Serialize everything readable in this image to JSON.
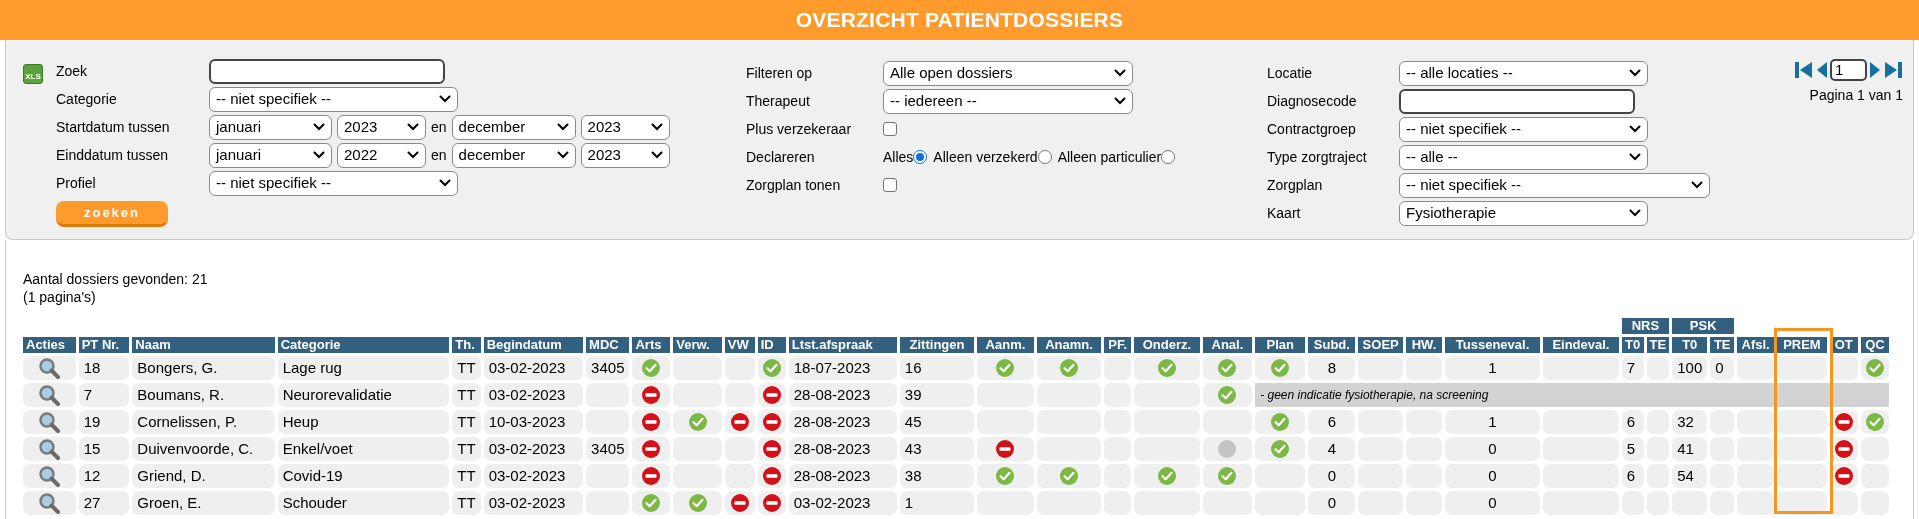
{
  "title": "OVERZICHT PATIENTDOSSIERS",
  "filters": {
    "export_label": "XLS",
    "left": [
      {
        "kind": "text",
        "label": "Zoek"
      },
      {
        "kind": "select",
        "label": "Categorie",
        "value": "-- niet specifiek --"
      },
      {
        "kind": "daterange",
        "label": "Startdatum tussen",
        "from_month": "januari",
        "from_year": "2023",
        "separator": "en",
        "to_month": "december",
        "to_year": "2023"
      },
      {
        "kind": "daterange",
        "label": "Einddatum tussen",
        "from_month": "januari",
        "from_year": "2022",
        "separator": "en",
        "to_month": "december",
        "to_year": "2023"
      },
      {
        "kind": "select",
        "label": "Profiel",
        "value": "-- niet specifiek --"
      }
    ],
    "search_button": "zoeken",
    "middle": [
      {
        "kind": "select",
        "label": "Filteren op",
        "value": "Alle open dossiers"
      },
      {
        "kind": "select",
        "label": "Therapeut",
        "value": "-- iedereen --"
      },
      {
        "kind": "checkbox",
        "label": "Plus verzekeraar",
        "checked": false
      },
      {
        "kind": "radio",
        "label": "Declareren",
        "options": [
          {
            "label": "Alles",
            "selected": true
          },
          {
            "label": "Alleen verzekerd",
            "selected": false
          },
          {
            "label": "Alleen particulier",
            "selected": false
          }
        ]
      },
      {
        "kind": "checkbox",
        "label": "Zorgplan tonen",
        "checked": false
      }
    ],
    "right": [
      {
        "kind": "select",
        "label": "Locatie",
        "value": "-- alle locaties --"
      },
      {
        "kind": "text",
        "label": "Diagnosecode"
      },
      {
        "kind": "select",
        "label": "Contractgroep",
        "value": "-- niet specifiek --"
      },
      {
        "kind": "select",
        "label": "Type zorgtraject",
        "value": "-- alle --"
      },
      {
        "kind": "select",
        "label": "Zorgplan",
        "value": "-- niet specifiek --",
        "wide": true
      },
      {
        "kind": "select",
        "label": "Kaart",
        "value": "Fysiotherapie"
      }
    ]
  },
  "pager": {
    "page": "1",
    "info": "Pagina 1 van 1"
  },
  "results": {
    "count": "Aantal dossiers gevonden: 21",
    "pages": "(1 pagina's)"
  },
  "table": {
    "columns": [
      {
        "label": "Acties",
        "highlighted": false
      },
      {
        "label": "PT Nr.",
        "highlighted": false
      },
      {
        "label": "Naam",
        "highlighted": false
      },
      {
        "label": "Categorie",
        "highlighted": false
      },
      {
        "label": "Th.",
        "highlighted": false
      },
      {
        "label": "Begindatum",
        "highlighted": false
      },
      {
        "label": "MDC",
        "highlighted": false
      },
      {
        "label": "Arts",
        "highlighted": false
      },
      {
        "label": "Verw.",
        "highlighted": false
      },
      {
        "label": "VW",
        "highlighted": false
      },
      {
        "label": "ID",
        "highlighted": false
      },
      {
        "label": "Ltst.afspraak",
        "highlighted": false
      },
      {
        "label": "Zittingen",
        "highlighted": false
      },
      {
        "label": "Aanm.",
        "highlighted": false
      },
      {
        "label": "Anamn.",
        "highlighted": false
      },
      {
        "label": "PF.",
        "highlighted": false
      },
      {
        "label": "Onderz.",
        "highlighted": false
      },
      {
        "label": "Anal.",
        "highlighted": false
      },
      {
        "label": "Plan",
        "highlighted": false
      },
      {
        "label": "Subd.",
        "highlighted": false
      },
      {
        "label": "SOEP",
        "highlighted": false
      },
      {
        "label": "HW.",
        "highlighted": false
      },
      {
        "label": "Tusseneval.",
        "highlighted": false
      },
      {
        "label": "Eindeval.",
        "highlighted": false
      },
      {
        "label": "T0",
        "highlighted": false
      },
      {
        "label": "TE",
        "highlighted": false
      },
      {
        "label": "T0",
        "highlighted": false
      },
      {
        "label": "TE",
        "highlighted": false
      },
      {
        "label": "Afsl.",
        "highlighted": false
      },
      {
        "label": "PREM",
        "highlighted": true
      },
      {
        "label": "OT",
        "highlighted": false
      },
      {
        "label": "QC",
        "highlighted": false
      }
    ],
    "column_groups": [
      {
        "label": "NRS"
      },
      {
        "label": "PSK"
      }
    ],
    "rows": [
      {
        "cells": [
          {
            "kind": "view"
          },
          "18",
          "Bongers, G.",
          "Lage rug",
          "TT",
          "03-02-2023",
          "3405",
          {
            "kind": "check"
          },
          null,
          null,
          {
            "kind": "check"
          },
          "18-07-2023",
          "16",
          {
            "kind": "check"
          },
          {
            "kind": "check"
          },
          null,
          {
            "kind": "check"
          },
          {
            "kind": "check"
          },
          {
            "kind": "check"
          },
          "8",
          null,
          null,
          "1",
          null,
          "7",
          null,
          "100",
          "0",
          null,
          null,
          null,
          {
            "kind": "check"
          }
        ]
      },
      {
        "cells": [
          {
            "kind": "view"
          },
          "7",
          "Boumans, R.",
          "Neurorevalidatie",
          "TT",
          "03-02-2023",
          null,
          {
            "kind": "stop"
          },
          null,
          null,
          {
            "kind": "stop"
          },
          "28-08-2023",
          "39",
          null,
          null,
          null,
          null,
          {
            "kind": "check"
          }
        ],
        "note": "- geen indicatie fysiotherapie, na screening"
      },
      {
        "cells": [
          {
            "kind": "view"
          },
          "19",
          "Cornelissen, P.",
          "Heup",
          "TT",
          "10-03-2023",
          null,
          {
            "kind": "stop"
          },
          {
            "kind": "check"
          },
          {
            "kind": "stop"
          },
          {
            "kind": "stop"
          },
          "28-08-2023",
          "45",
          null,
          null,
          null,
          null,
          null,
          {
            "kind": "check"
          },
          "6",
          null,
          null,
          "1",
          null,
          "6",
          null,
          "32",
          null,
          null,
          null,
          {
            "kind": "stop"
          },
          {
            "kind": "check"
          }
        ]
      },
      {
        "cells": [
          {
            "kind": "view"
          },
          "15",
          "Duivenvoorde, C.",
          "Enkel/voet",
          "TT",
          "03-02-2023",
          "3405",
          {
            "kind": "stop"
          },
          null,
          null,
          {
            "kind": "stop"
          },
          "28-08-2023",
          "43",
          {
            "kind": "stop"
          },
          null,
          null,
          null,
          {
            "kind": "pending"
          },
          {
            "kind": "check"
          },
          "4",
          null,
          null,
          "0",
          null,
          "5",
          null,
          "41",
          null,
          null,
          null,
          {
            "kind": "stop"
          },
          null
        ]
      },
      {
        "cells": [
          {
            "kind": "view"
          },
          "12",
          "Griend, D.",
          "Covid-19",
          "TT",
          "03-02-2023",
          null,
          {
            "kind": "stop"
          },
          null,
          null,
          {
            "kind": "stop"
          },
          "28-08-2023",
          "38",
          {
            "kind": "check"
          },
          {
            "kind": "check"
          },
          null,
          {
            "kind": "check"
          },
          {
            "kind": "check"
          },
          null,
          "0",
          null,
          null,
          "0",
          null,
          "6",
          null,
          "54",
          null,
          null,
          null,
          {
            "kind": "stop"
          },
          null
        ]
      },
      {
        "cells": [
          {
            "kind": "view"
          },
          "27",
          "Groen, E.",
          "Schouder",
          "TT",
          "03-02-2023",
          null,
          {
            "kind": "check"
          },
          {
            "kind": "check"
          },
          {
            "kind": "stop"
          },
          {
            "kind": "stop"
          },
          "03-02-2023",
          "1",
          null,
          null,
          null,
          null,
          null,
          null,
          "0",
          null,
          null,
          "0",
          null,
          null,
          null,
          null,
          null,
          null,
          null,
          null,
          null
        ]
      }
    ]
  }
}
